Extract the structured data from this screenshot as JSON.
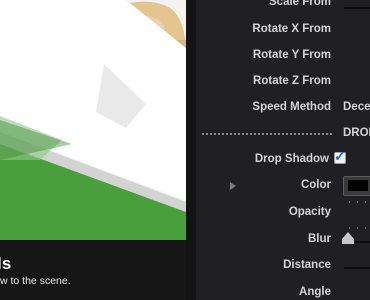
{
  "preview": {
    "title_fragment": "ls",
    "description_fragment": "w to the scene."
  },
  "inspector": {
    "rows": [
      {
        "label": "Scale From"
      },
      {
        "label": "Rotate X From"
      },
      {
        "label": "Rotate Y From"
      },
      {
        "label": "Rotate Z From"
      },
      {
        "label": "Speed Method",
        "value": "Dece"
      },
      {
        "section": "DROP"
      },
      {
        "label": "Drop Shadow",
        "checked": true
      },
      {
        "label": "Color",
        "color": "#000000"
      },
      {
        "label": "Opacity"
      },
      {
        "label": "Blur"
      },
      {
        "label": "Distance"
      },
      {
        "label": "Angle"
      }
    ]
  },
  "colors": {
    "panel_bg": "#202022",
    "label_text": "#d4d4d4",
    "shape_green": "#4a9f3d",
    "checkbox_blue": "#1c64d6"
  }
}
